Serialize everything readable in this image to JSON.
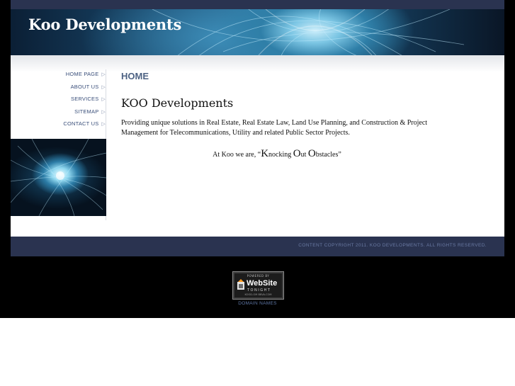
{
  "header": {
    "site_title": "Koo Developments"
  },
  "nav": {
    "items": [
      {
        "label": "HOME PAGE"
      },
      {
        "label": "ABOUT US"
      },
      {
        "label": "SERVICES"
      },
      {
        "label": "SITEMAP"
      },
      {
        "label": "CONTACT US"
      }
    ],
    "arrow_glyph": "▷"
  },
  "main": {
    "heading": "HOME",
    "company_name": "KOO Developments",
    "description": "Providing unique solutions in Real Estate, Real Estate Law, Land Use Planning, and Construction & Project Management for Telecommunications, Utility and related Public Sector Projects.",
    "motto": {
      "prefix": "At Koo we are, “",
      "k": "K",
      "k_rest": "nocking ",
      "o": "O",
      "o_rest": "ut ",
      "o2": "O",
      "o2_rest": "bstacles",
      "suffix": "”"
    }
  },
  "footer": {
    "copyright": "CONTENT COPYRIGHT 2011. KOO DEVELOPMENTS. ALL RIGHTS RESERVED."
  },
  "badge": {
    "powered_by": "POWERED BY",
    "title": "WebSite",
    "subtitle": "TONIGHT",
    "url": "KOOD-OM BBVA.COM"
  },
  "domain_link": "DOMAIN NAMES",
  "colors": {
    "bar": "#2a3350",
    "heading": "#4d6283",
    "nav_text": "#3a4f7a"
  }
}
